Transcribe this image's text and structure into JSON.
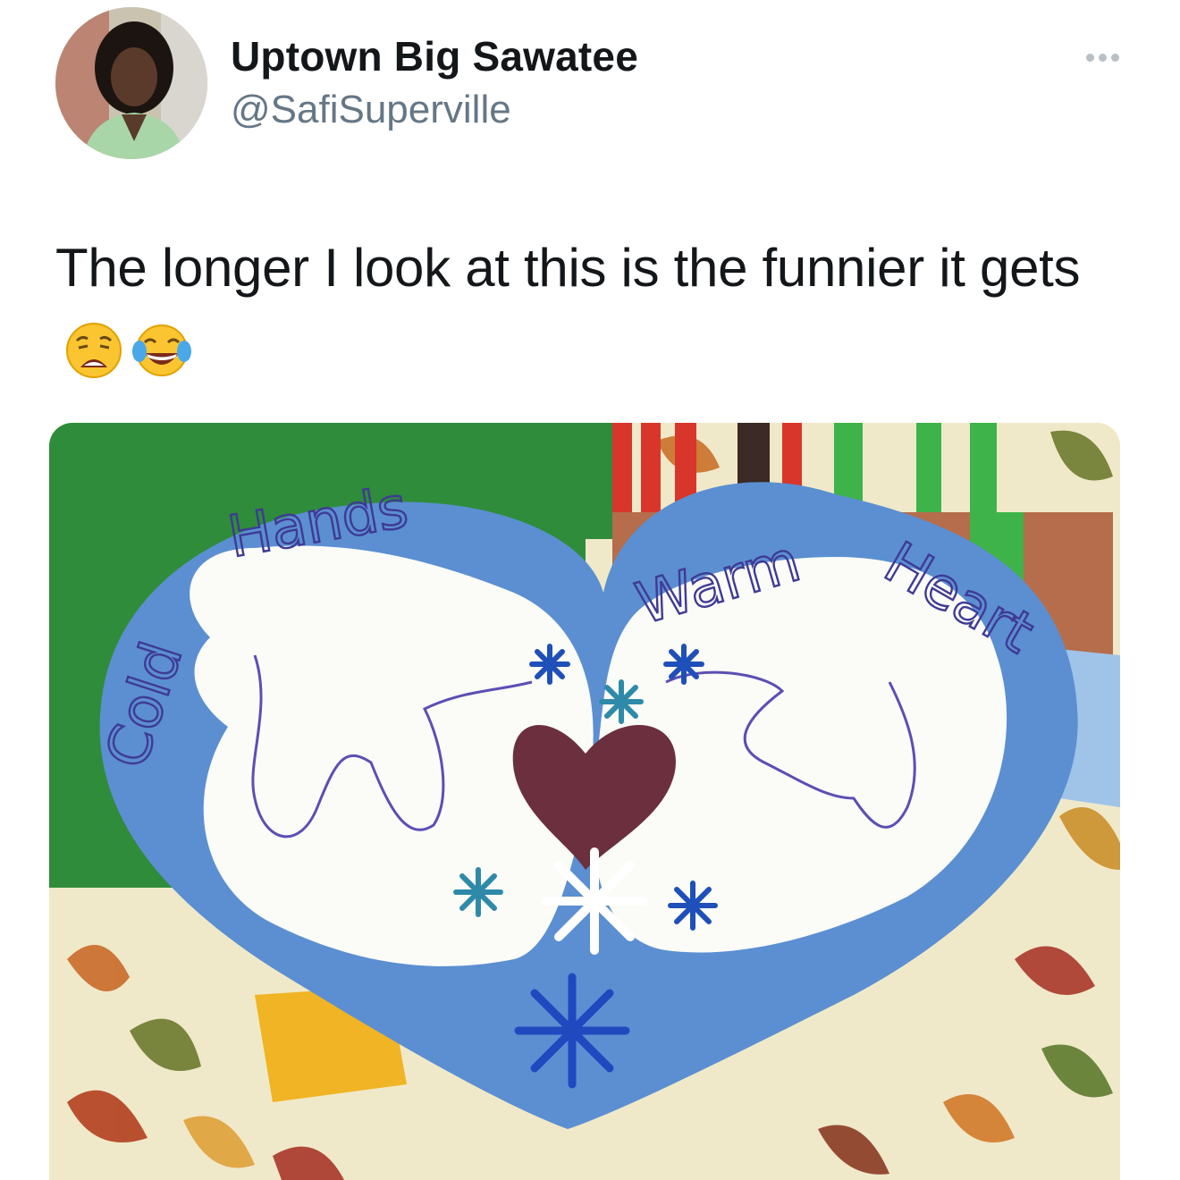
{
  "tweet": {
    "author": {
      "display_name": "Uptown Big Sawatee",
      "handle": "@SafiSuperville",
      "avatar_icon": "profile-photo"
    },
    "more_icon": "more-options-icon",
    "text": "The longer I look at this is the funnier it gets",
    "emojis": [
      "weary-face-emoji",
      "face-with-tears-of-joy-emoji"
    ]
  },
  "media": {
    "craft_words": {
      "cold": "Cold",
      "hands": "Hands",
      "warm": "Warm",
      "heart": "Heart"
    },
    "colors": {
      "heart_paper": "#5b8fd1",
      "hand_paper": "#fbfbf8",
      "green_paper": "#2f8c3a",
      "drawn_heart": "#6b2f3e"
    }
  }
}
